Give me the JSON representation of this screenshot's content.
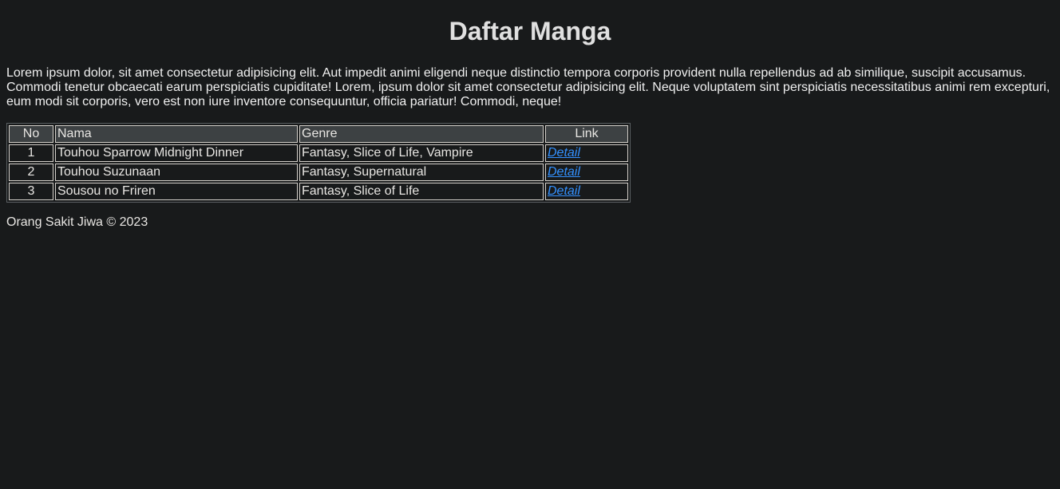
{
  "page_title": "Daftar Manga",
  "intro_text": "Lorem ipsum dolor, sit amet consectetur adipisicing elit. Aut impedit animi eligendi neque distinctio tempora corporis provident nulla repellendus ad ab similique, suscipit accusamus. Commodi tenetur obcaecati earum perspiciatis cupiditate! Lorem, ipsum dolor sit amet consectetur adipisicing elit. Neque voluptatem sint perspiciatis necessitatibus animi rem excepturi, eum modi sit corporis, vero est non iure inventore consequuntur, officia pariatur! Commodi, neque!",
  "table": {
    "headers": {
      "no": "No",
      "nama": "Nama",
      "genre": "Genre",
      "link": "Link"
    },
    "rows": [
      {
        "no": "1",
        "nama": "Touhou Sparrow Midnight Dinner",
        "genre": "Fantasy, Slice of Life, Vampire",
        "link": "Detail"
      },
      {
        "no": "2",
        "nama": "Touhou Suzunaan",
        "genre": "Fantasy, Supernatural",
        "link": "Detail"
      },
      {
        "no": "3",
        "nama": "Sousou no Friren",
        "genre": "Fantasy, Slice of Life",
        "link": "Detail"
      }
    ]
  },
  "footer_text": "Orang Sakit Jiwa © 2023",
  "colors": {
    "background": "#181a1b",
    "text": "#e8e6e3",
    "header_bg": "#3d4143",
    "link": "#3391ff"
  }
}
